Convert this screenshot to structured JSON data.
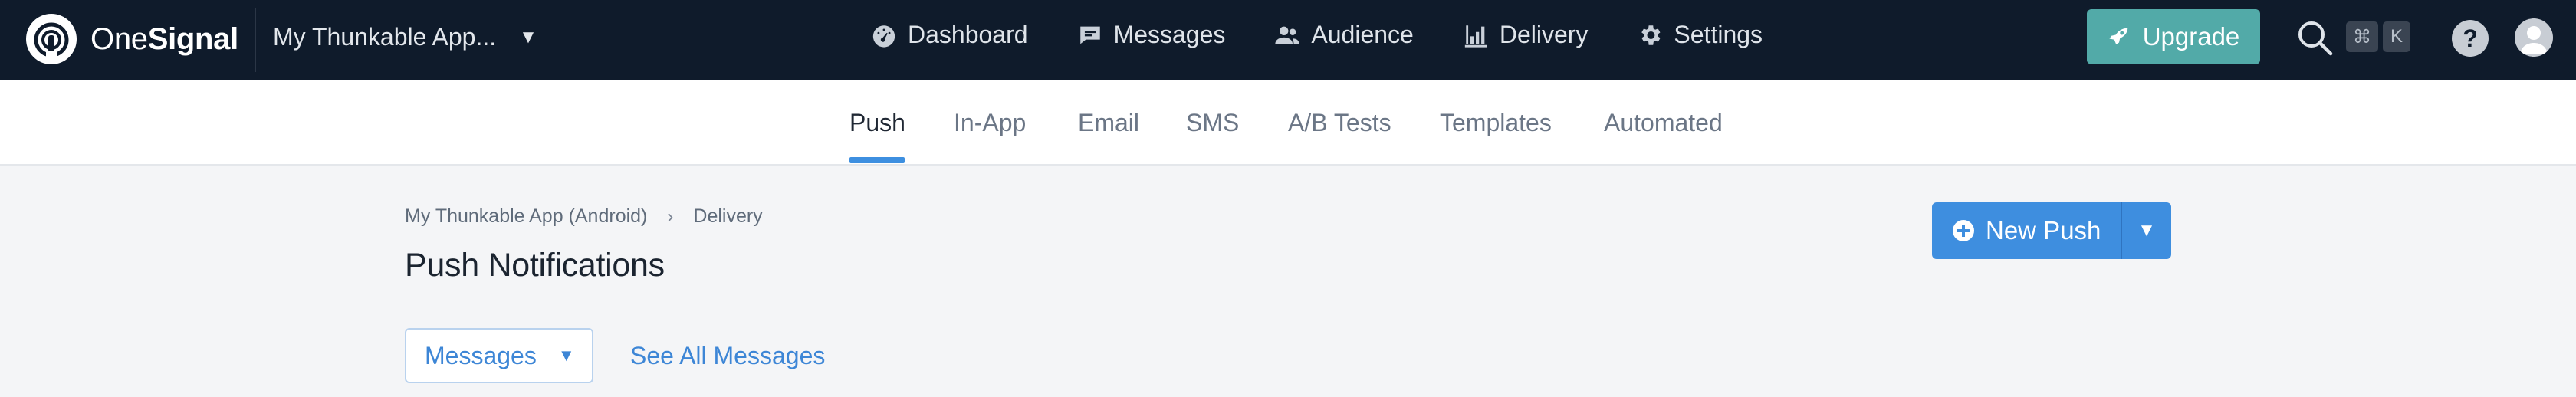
{
  "topbar": {
    "logo": {
      "one": "One",
      "signal": "Signal",
      "icon": "onesignal-logo-icon"
    },
    "app_selector": {
      "name": "My Thunkable App...",
      "caret_icon": "caret-down-icon"
    },
    "nav": [
      {
        "label": "Dashboard",
        "icon": "gauge-icon"
      },
      {
        "label": "Messages",
        "icon": "chat-bubble-icon"
      },
      {
        "label": "Audience",
        "icon": "users-icon"
      },
      {
        "label": "Delivery",
        "icon": "chart-icon"
      },
      {
        "label": "Settings",
        "icon": "gear-icon"
      }
    ],
    "upgrade_label": "Upgrade",
    "shortcut_cmd": "⌘",
    "shortcut_key": "K",
    "help_label": "?"
  },
  "subnav": {
    "tabs": [
      "Push",
      "In-App",
      "Email",
      "SMS",
      "A/B Tests",
      "Templates",
      "Automated"
    ],
    "active": "Push"
  },
  "content": {
    "breadcrumb": [
      "My Thunkable App (Android)",
      "Delivery"
    ],
    "breadcrumb_sep": "›",
    "title": "Push Notifications",
    "new_push_label": "New Push",
    "filter_label": "Messages",
    "see_all_label": "See All Messages"
  },
  "colors": {
    "topbar_bg": "#0f1b2b",
    "upgrade_bg": "#52aaa8",
    "primary": "#3e8edf",
    "page_bg": "#f4f5f7"
  }
}
